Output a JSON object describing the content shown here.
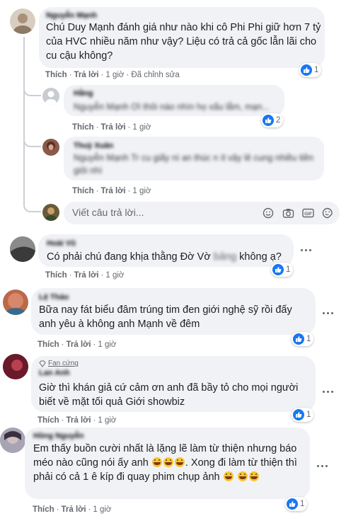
{
  "actions": {
    "like": "Thích",
    "reply": "Trả lời",
    "dot": "·",
    "edited": "Đã chỉnh sửa"
  },
  "comments": [
    {
      "author": "Nguyễn Mạnh",
      "text": "Chú Duy Mạnh đánh giá như nào khi cô Phi Phi giữ hơn 7 tỷ của HVC nhiều năm như vậy? Liệu có trả cả gốc lẫn lãi cho cu cậu không?",
      "time": "1 giờ",
      "reactions": "1",
      "avatar_color": "#c9b9a6"
    },
    {
      "author": "Hằng",
      "text": "Nguyễn Mạnh Ơi thôi nào nhìn họ xấu lắm, mạn...",
      "time": "1 giờ",
      "reactions": "2",
      "avatar_color": "#c8ccd2"
    },
    {
      "author": "Thuỳ Xuân",
      "text": "Nguyễn Mạnh Tr cu giấy nì an thúc n ít vậy lẻ cung nhiều tiền giôi nhì",
      "time": "1 giờ",
      "avatar_color": "#8a5a4a"
    },
    {
      "author": "Hoài Vũ",
      "text": "Có phải chú đang khịa thằng Đờ Vờ",
      "text_blurred": "bảng",
      "text_end": "không ạ?",
      "time": "1 giờ",
      "reactions": "1",
      "avatar_color": "#5d5d5d"
    },
    {
      "author": "Lệ Thảo",
      "text": "Bữa nay fát biểu đâm trúng tim đen giới nghệ sỹ rồi đấy anh yêu à không anh Mạnh về đêm",
      "time": "1 giờ",
      "reactions": "1",
      "avatar_color": "#b86a4a"
    },
    {
      "badge": "Fan cứng",
      "author": "Lan Anh",
      "text": "Giờ thì khán giả cứ cảm ơn anh đã bầy tỏ cho mọi người biết về mặt tối quả Giới showbiz",
      "time": "1 giờ",
      "reactions": "1",
      "avatar_color": "#7a2030"
    },
    {
      "author": "Hồng Nguyễn",
      "text_1": "Em thấy buồn cười nhất là lặng lẽ làm từ thiện nhưng báo méo nào cũng nói ấy anh",
      "text_2": ". Xong đi làm từ thiện thì phải có cả 1 ê kíp đi quay phim chụp ảnh",
      "time": "1 giờ",
      "reactions": "1",
      "avatar_color": "#9a9ca8"
    }
  ],
  "reply_box": {
    "placeholder": "Viết câu trả lời..."
  },
  "icons": {
    "like": "like-icon",
    "haha": "haha-icon",
    "emoji": "laughing-emoji-icon",
    "smile": "smile-icon",
    "camera": "camera-icon",
    "gif": "gif-icon",
    "sticker": "sticker-icon",
    "more": "more-options-icon"
  },
  "colors": {
    "bubble": "#f0f2f5",
    "meta": "#65676b",
    "like_blue": "#1877f2"
  }
}
